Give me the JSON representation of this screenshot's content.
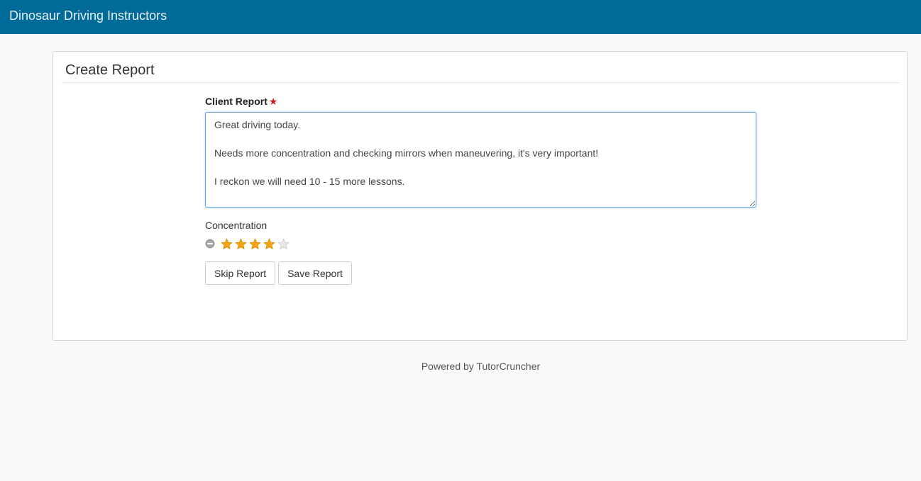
{
  "header": {
    "brand": "Dinosaur Driving Instructors"
  },
  "form": {
    "title": "Create Report",
    "client_report": {
      "label": "Client Report",
      "required_marker": "★",
      "value": "Great driving today.\n\nNeeds more concentration and checking mirrors when maneuvering, it's very important!\n\nI reckon we will need 10 - 15 more lessons."
    },
    "rating": {
      "label": "Concentration",
      "value": 4,
      "max": 5,
      "clear_icon": "minus-circle-icon",
      "filled_color": "#f2a414",
      "empty_color": "#e8e8e8"
    },
    "buttons": {
      "skip_label": "Skip Report",
      "save_label": "Save Report"
    }
  },
  "footer": {
    "text": "Powered by TutorCruncher"
  },
  "colors": {
    "header_bg": "#006b99",
    "page_bg": "#f9f9f9",
    "required": "#c81e1e",
    "focus_border": "#66a6e8"
  }
}
